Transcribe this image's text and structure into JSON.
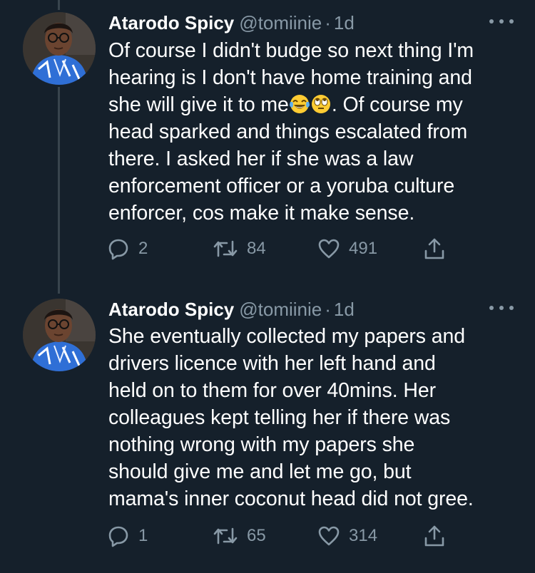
{
  "tweets": [
    {
      "author_name": "Atarodo Spicy",
      "handle": "@tomiinie",
      "separator": "·",
      "time": "1d",
      "lines": [
        "Of course I didn't budge so next thing I'm",
        "hearing is I don't have home training and",
        "she will give it to me",
        ". Of course my",
        "head sparked and things escalated from",
        "there. I asked her if she was a law",
        "enforcement officer or a yoruba culture",
        "enforcer, cos make it make sense."
      ],
      "emoji": [
        "face-with-tears-of-joy-emoji",
        "face-with-rolling-eyes-emoji"
      ],
      "reply_count": "2",
      "retweet_count": "84",
      "like_count": "491"
    },
    {
      "author_name": "Atarodo Spicy",
      "handle": "@tomiinie",
      "separator": "·",
      "time": "1d",
      "lines": [
        "She eventually collected my papers and",
        "drivers licence with her left hand and",
        "held on to them for over 40mins. Her",
        "colleagues kept telling her if there was",
        "nothing wrong with my papers she",
        "should give me and let me go, but",
        "mama's inner coconut head did not gree."
      ],
      "reply_count": "1",
      "retweet_count": "65",
      "like_count": "314"
    }
  ],
  "icons": {
    "reply": "reply-icon",
    "retweet": "retweet-icon",
    "like": "heart-icon",
    "share": "share-icon",
    "more": "more-options-icon"
  },
  "colors": {
    "background": "#15202b",
    "text": "#ffffff",
    "secondary_text": "#8899a6",
    "thread_line": "#38444d"
  }
}
